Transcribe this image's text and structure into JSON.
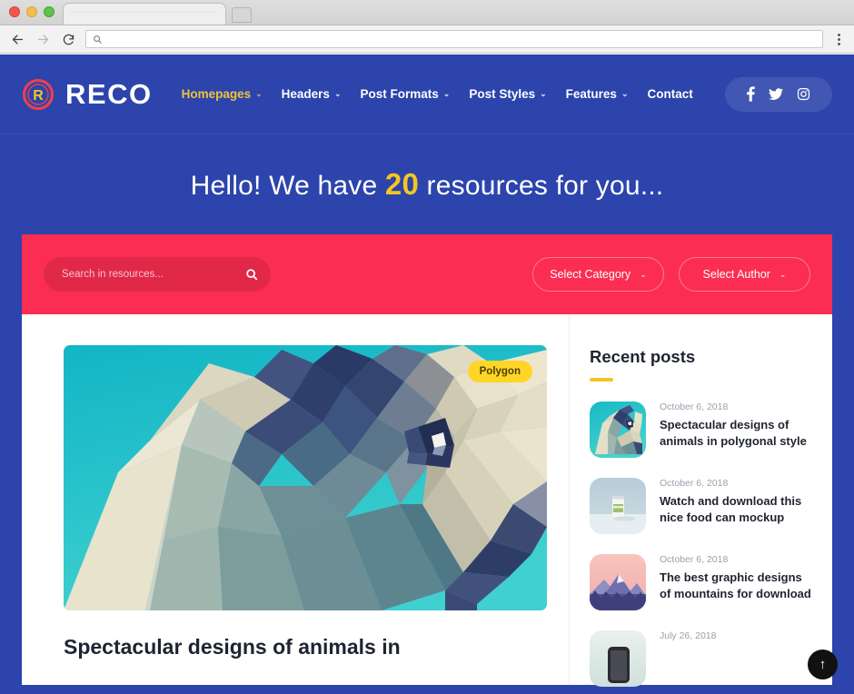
{
  "browser": {
    "tab_title": "",
    "url": "",
    "back_icon": "back-arrow-icon",
    "forward_icon": "forward-arrow-icon",
    "reload_icon": "reload-icon",
    "menu_icon": "kebab-menu-icon"
  },
  "site": {
    "logo_text": "RECO",
    "nav": [
      {
        "label": "Homepages",
        "has_caret": true,
        "active": true
      },
      {
        "label": "Headers",
        "has_caret": true,
        "active": false
      },
      {
        "label": "Post Formats",
        "has_caret": true,
        "active": false
      },
      {
        "label": "Post Styles",
        "has_caret": true,
        "active": false
      },
      {
        "label": "Features",
        "has_caret": true,
        "active": false
      },
      {
        "label": "Contact",
        "has_caret": false,
        "active": false
      }
    ],
    "social": [
      {
        "name": "facebook-icon"
      },
      {
        "name": "twitter-icon"
      },
      {
        "name": "instagram-icon"
      }
    ],
    "caret": "⌄"
  },
  "hero": {
    "prefix": "Hello! We have",
    "count": "20",
    "suffix": "resources for you..."
  },
  "filter": {
    "search_value": "",
    "search_placeholder": "Search in resources...",
    "search_icon": "search-icon",
    "category_label": "Select Category",
    "author_label": "Select Author",
    "caret": "⌄"
  },
  "featured": {
    "badge": "Polygon",
    "title": "Spectacular designs of animals in"
  },
  "sidebar": {
    "heading": "Recent posts",
    "posts": [
      {
        "date": "October 6, 2018",
        "title": "Spectacular designs of animals in polygonal style",
        "thumb": "dog-polygon-thumb"
      },
      {
        "date": "October 6, 2018",
        "title": "Watch and download this nice food can mockup",
        "thumb": "food-can-thumb"
      },
      {
        "date": "October 6, 2018",
        "title": "The best graphic designs of mountains for download",
        "thumb": "mountains-thumb"
      },
      {
        "date": "July 26, 2018",
        "title": "",
        "thumb": "phone-thumb"
      }
    ]
  },
  "scroll_top": {
    "icon": "arrow-up-icon",
    "glyph": "↑"
  },
  "colors": {
    "header_blue": "#2c44ab",
    "accent_red": "#fb2d52",
    "accent_yellow": "#f5c521",
    "badge_yellow": "#ffd626",
    "text_dark": "#1f2430"
  }
}
